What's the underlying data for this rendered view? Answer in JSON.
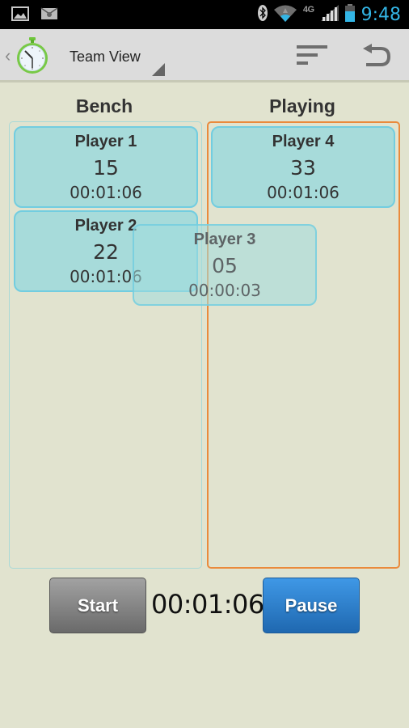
{
  "status_bar": {
    "left_icons": [
      "gallery-icon",
      "mail-notification-icon"
    ],
    "right_icons": [
      "bluetooth-icon",
      "wifi-icon",
      "4g-lte-icon",
      "signal-icon",
      "battery-icon"
    ],
    "network_label": "4G",
    "time": "9:48",
    "time_color": "#33b5e5"
  },
  "action_bar": {
    "title": "Team View",
    "icons": [
      "back-caret-icon",
      "stopwatch-icon",
      "sort-icon",
      "undo-icon"
    ]
  },
  "columns": {
    "bench": {
      "title": "Bench",
      "border_color": "#a9d9d7"
    },
    "playing": {
      "title": "Playing",
      "border_color": "#ea8a3c"
    }
  },
  "players": {
    "bench": [
      {
        "name": "Player 1",
        "number": "15",
        "time": "00:01:06"
      },
      {
        "name": "Player 2",
        "number": "22",
        "time": "00:01:06"
      }
    ],
    "playing": [
      {
        "name": "Player 4",
        "number": "33",
        "time": "00:01:06"
      }
    ],
    "dragging": {
      "name": "Player 3",
      "number": "05",
      "time": "00:00:03"
    }
  },
  "controls": {
    "start_label": "Start",
    "pause_label": "Pause",
    "game_clock": "00:01:06"
  },
  "colors": {
    "background": "#e1e3cf",
    "card_fill": "#96d8dc",
    "card_border": "#72cde0",
    "pause_button": "#2d7fd0",
    "start_button": "#858585"
  }
}
